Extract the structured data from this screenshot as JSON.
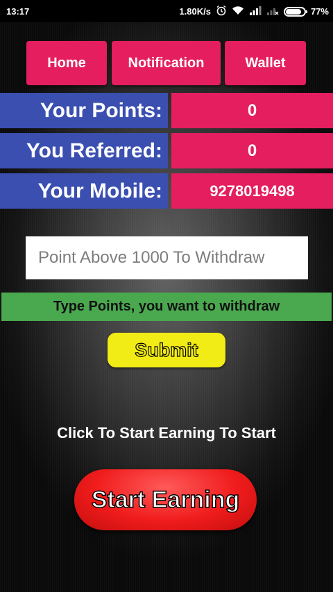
{
  "status_bar": {
    "time": "13:17",
    "network_speed": "1.80K/s",
    "battery": "77%",
    "icons": [
      "alarm-icon",
      "wifi-icon",
      "signal-icon",
      "signal-no-sim-icon",
      "battery-icon"
    ]
  },
  "nav": {
    "home_label": "Home",
    "notification_label": "Notification",
    "wallet_label": "Wallet"
  },
  "stats": {
    "points_label": "Your Points:",
    "points_value": "0",
    "referred_label": "You Referred:",
    "referred_value": "0",
    "mobile_label": "Your Mobile:",
    "mobile_value": "9278019498"
  },
  "withdraw": {
    "placeholder": "Point Above 1000 To Withdraw",
    "value": "",
    "hint": "Type Points, you want to withdraw",
    "submit_label": "Submit"
  },
  "earning": {
    "caption": "Click To Start Earning To Start",
    "button_label": "Start Earning"
  },
  "colors": {
    "nav_pink": "#e41e5f",
    "label_blue": "#3a4fb0",
    "hint_green": "#4aa84f",
    "submit_yellow": "#f2ec16",
    "start_red": "#f01c1c"
  }
}
